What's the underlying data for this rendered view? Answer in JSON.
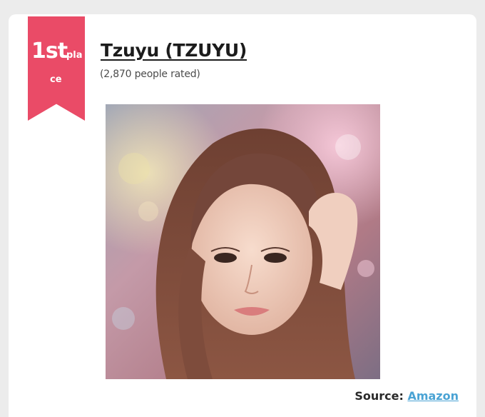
{
  "ranking": {
    "rank_number": "1st",
    "rank_suffix_line1": "pla",
    "rank_suffix_line2": "ce",
    "ribbon_color": "#ea4b67"
  },
  "entry": {
    "title": "Tzuyu (TZUYU)",
    "rated_text": "(2,870 people rated)",
    "photo_subject": "portrait photo"
  },
  "footer": {
    "source_label": "Source:",
    "source_link": "Amazon",
    "link_color": "#4aa3d4"
  }
}
